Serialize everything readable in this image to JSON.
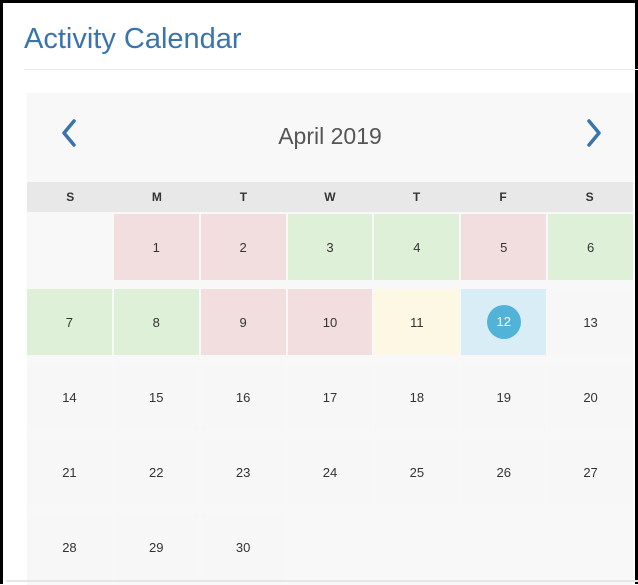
{
  "header": {
    "title": "Activity Calendar"
  },
  "calendar": {
    "month_label": "April 2019",
    "prev_icon": "chevron-left-icon",
    "next_icon": "chevron-right-icon",
    "weekdays": [
      "S",
      "M",
      "T",
      "W",
      "T",
      "F",
      "S"
    ],
    "first_weekday_offset": 1,
    "days": [
      {
        "day": "1",
        "status": "red"
      },
      {
        "day": "2",
        "status": "red"
      },
      {
        "day": "3",
        "status": "green"
      },
      {
        "day": "4",
        "status": "green"
      },
      {
        "day": "5",
        "status": "red"
      },
      {
        "day": "6",
        "status": "green"
      },
      {
        "day": "7",
        "status": "green"
      },
      {
        "day": "8",
        "status": "green"
      },
      {
        "day": "9",
        "status": "red"
      },
      {
        "day": "10",
        "status": "red"
      },
      {
        "day": "11",
        "status": "yellow"
      },
      {
        "day": "12",
        "status": "blue",
        "today": true
      },
      {
        "day": "13",
        "status": "none"
      },
      {
        "day": "14",
        "status": "none"
      },
      {
        "day": "15",
        "status": "none"
      },
      {
        "day": "16",
        "status": "none"
      },
      {
        "day": "17",
        "status": "none"
      },
      {
        "day": "18",
        "status": "none"
      },
      {
        "day": "19",
        "status": "none"
      },
      {
        "day": "20",
        "status": "none"
      },
      {
        "day": "21",
        "status": "none"
      },
      {
        "day": "22",
        "status": "none"
      },
      {
        "day": "23",
        "status": "none"
      },
      {
        "day": "24",
        "status": "none"
      },
      {
        "day": "25",
        "status": "none"
      },
      {
        "day": "26",
        "status": "none"
      },
      {
        "day": "27",
        "status": "none"
      },
      {
        "day": "28",
        "status": "none"
      },
      {
        "day": "29",
        "status": "none"
      },
      {
        "day": "30",
        "status": "none"
      }
    ]
  },
  "colors": {
    "title": "#3a74ab",
    "nav_arrow": "#3a74ab",
    "red": "#f2dede",
    "green": "#dff0d8",
    "yellow": "#fcf8e3",
    "blue": "#d9edf7",
    "today_badge": "#52b3d9"
  }
}
